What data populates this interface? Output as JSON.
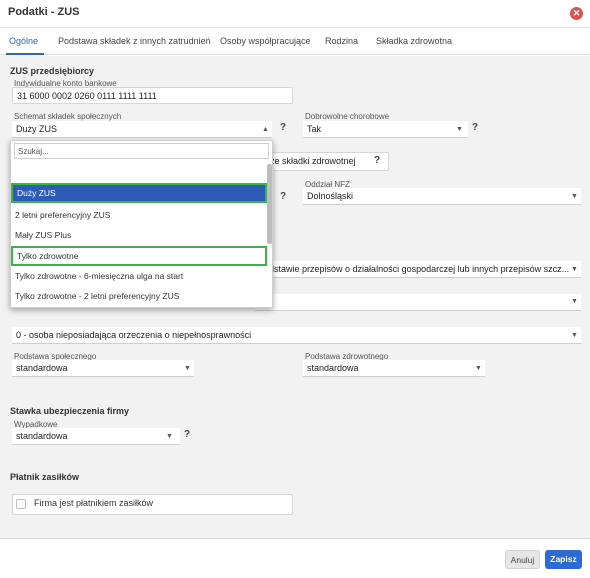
{
  "window": {
    "title": "Podatki - ZUS"
  },
  "tabs": [
    "Ogólne",
    "Podstawa składek z innych zatrudnień",
    "Osoby współpracujące",
    "Rodzina",
    "Składka zdrowotna"
  ],
  "zus": {
    "section_title": "ZUS przedsiębiorcy",
    "account_label": "Indywidualne konto bankowe",
    "account_value": "31 6000 0002 0260 0111 1111 1111",
    "scheme_label": "Schemat składek społecznych",
    "scheme_value": "Duży ZUS",
    "voluntary_label": "Dobrowolne chorobowe",
    "voluntary_value": "Tak",
    "health_partial_label": "ze składki zdrowotnej",
    "nfz_label": "Oddział NFZ",
    "nfz_value": "Dolnośląski",
    "title_partial": "podstawie przepisów o działalności gospodarczej lub innych przepisów szcz...",
    "disability_value": "0 - osoba nieposiadająca orzeczenia o niepełnosprawności",
    "social_base_label": "Podstawa społecznego",
    "social_base_value": "standardowa",
    "health_base_label": "Podstawa zdrowotnego",
    "health_base_value": "standardowa"
  },
  "dropdown": {
    "search_placeholder": "Szukaj...",
    "options": [
      "Duży ZUS",
      "2 letni preferencyjny ZUS",
      "Mały ZUS Plus",
      "Tylko zdrowotne",
      "Tylko zdrowotne - 6-miesięczna ulga na start",
      "Tylko zdrowotne - 2 letni preferencyjny ZUS"
    ]
  },
  "insurance": {
    "section_title": "Stawka ubezpieczenia firmy",
    "accident_label": "Wypadkowe",
    "accident_value": "standardowa"
  },
  "payer": {
    "section_title": "Płatnik zasiłków",
    "checkbox_label": "Firma jest płatnikiem zasiłków"
  },
  "footer": {
    "cancel": "Anuluj",
    "save": "Zapisz"
  },
  "symbols": {
    "help": "?",
    "caret": "▼",
    "caret_up": "▲",
    "close": "✕"
  },
  "colors": {
    "accent": "#2d6ab4",
    "selected": "#2d5bb7",
    "highlight": "#3cb44b",
    "close": "#d9534f"
  }
}
